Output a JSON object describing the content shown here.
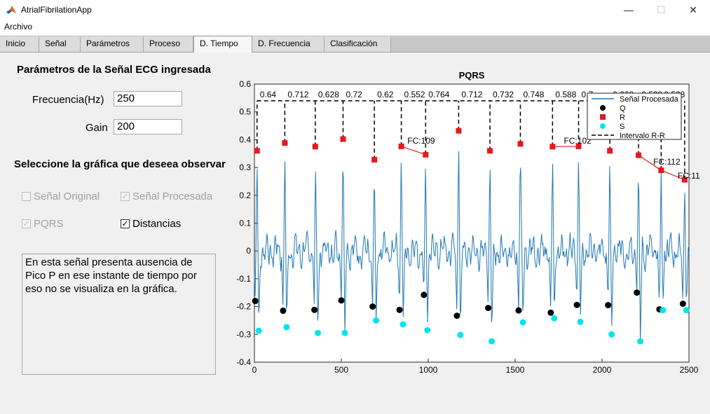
{
  "window": {
    "title": "AtrialFibrilationApp",
    "minimize": "—",
    "maximize": "☐",
    "close": "✕"
  },
  "menu": {
    "archivo": "Archivo"
  },
  "tabs": [
    "Inicio",
    "Señal",
    "Parámetros",
    "Proceso",
    "D. Tiempo",
    "D. Frecuencia",
    "Clasificación"
  ],
  "active_tab": "D. Tiempo",
  "params": {
    "heading": "Parámetros de la Señal ECG ingresada",
    "freq_label": "Frecuencia(Hz)",
    "freq_value": "250",
    "gain_label": "Gain",
    "gain_value": "200"
  },
  "select": {
    "heading": "Seleccione la gráfica que deseea observar",
    "opt_original": "Señal Original",
    "opt_original_checked": false,
    "opt_procesada": "Señal Procesada",
    "opt_procesada_checked": true,
    "opt_pqrs": "PQRS",
    "opt_pqrs_checked": true,
    "opt_distancias": "Distancias",
    "opt_distancias_checked": true
  },
  "note": "En esta señal presenta ausencia de Pico P en ese instante de tiempo por eso no se visualiza en la gráfica.",
  "colors": {
    "signal": "#1f77b4",
    "q": "#000000",
    "r": "#e31a1c",
    "s": "#00e5ee"
  },
  "chart_data": {
    "type": "line",
    "title": "PQRS",
    "xlim": [
      0,
      2500
    ],
    "ylim": [
      -0.4,
      0.6
    ],
    "xticks": [
      0,
      500,
      1000,
      1500,
      2000,
      2500
    ],
    "yticks": [
      -0.4,
      -0.3,
      -0.2,
      -0.1,
      0,
      0.1,
      0.2,
      0.3,
      0.4,
      0.5,
      0.6
    ],
    "legend": [
      "Señal Procesada",
      "Q",
      "R",
      "S",
      "Intervalo R-R"
    ],
    "legend_position": "top-right",
    "r_peaks": {
      "x": [
        15,
        175,
        350,
        510,
        690,
        845,
        985,
        1175,
        1355,
        1530,
        1715,
        1865,
        2045,
        2210,
        2340,
        2475
      ],
      "y": [
        0.36,
        0.388,
        0.375,
        0.402,
        0.328,
        0.376,
        0.346,
        0.432,
        0.36,
        0.385,
        0.375,
        0.376,
        0.36,
        0.344,
        0.29,
        0.256
      ]
    },
    "q_points": {
      "x": [
        5,
        165,
        345,
        500,
        680,
        835,
        975,
        1165,
        1345,
        1520,
        1705,
        1855,
        2035,
        2200,
        2330,
        2465
      ],
      "y": [
        -0.18,
        -0.215,
        -0.212,
        -0.178,
        -0.2,
        -0.212,
        -0.158,
        -0.233,
        -0.205,
        -0.214,
        -0.222,
        -0.194,
        -0.195,
        -0.15,
        -0.21,
        -0.19
      ]
    },
    "s_points": {
      "x": [
        25,
        185,
        365,
        520,
        700,
        855,
        995,
        1185,
        1365,
        1545,
        1725,
        1875,
        2055,
        2220,
        2350,
        2485
      ],
      "y": [
        -0.287,
        -0.274,
        -0.295,
        -0.295,
        -0.25,
        -0.264,
        -0.285,
        -0.302,
        -0.325,
        -0.257,
        -0.242,
        -0.255,
        -0.3,
        -0.325,
        -0.213,
        -0.213
      ]
    },
    "rr_labels": [
      "0.64",
      "0.712",
      "0.628",
      "0.72",
      "0.62",
      "0.552",
      "0.764",
      "0.712",
      "0.732",
      "0.748",
      "0.588",
      "0.7",
      "0.668",
      "0.528",
      "0.528"
    ],
    "fc_labels": [
      {
        "text": "FC:109",
        "x": 880,
        "y": 0.376
      },
      {
        "text": "FC:102",
        "x": 1780,
        "y": 0.376
      },
      {
        "text": "FC:112",
        "x": 2295,
        "y": 0.3
      },
      {
        "text": "FC:11",
        "x": 2435,
        "y": 0.25
      }
    ]
  }
}
